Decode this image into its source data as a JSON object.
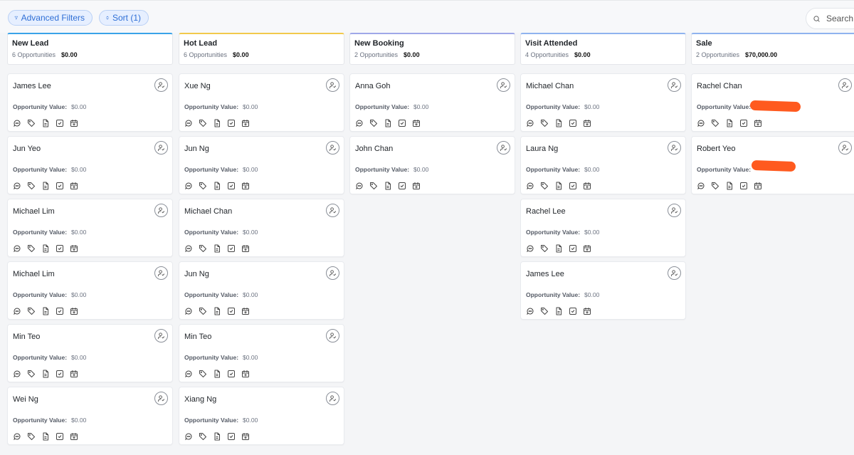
{
  "toolbar": {
    "filters_label": "Advanced Filters",
    "sort_label": "Sort (1)",
    "search_placeholder": "Search"
  },
  "card_labels": {
    "opportunity_value": "Opportunity Value:"
  },
  "colors": {
    "accent": "#2f6fd6",
    "redaction": "#ff5a1f"
  },
  "columns": [
    {
      "title": "New Lead",
      "count": "6 Opportunities",
      "amount": "$0.00",
      "accent": "#3aa3e8",
      "cards": [
        {
          "name": "James Lee",
          "value": "$0.00"
        },
        {
          "name": "Jun Yeo",
          "value": "$0.00"
        },
        {
          "name": "Michael Lim",
          "value": "$0.00"
        },
        {
          "name": "Michael Lim",
          "value": "$0.00"
        },
        {
          "name": "Min Teo",
          "value": "$0.00"
        },
        {
          "name": "Wei Ng",
          "value": "$0.00"
        }
      ]
    },
    {
      "title": "Hot Lead",
      "count": "6 Opportunities",
      "amount": "$0.00",
      "accent": "#f2c94c",
      "cards": [
        {
          "name": "Xue Ng",
          "value": "$0.00"
        },
        {
          "name": "Jun Ng",
          "value": "$0.00"
        },
        {
          "name": "Michael Chan",
          "value": "$0.00"
        },
        {
          "name": "Jun Ng",
          "value": "$0.00"
        },
        {
          "name": "Min Teo",
          "value": "$0.00"
        },
        {
          "name": "Xiang Ng",
          "value": "$0.00"
        }
      ]
    },
    {
      "title": "New Booking",
      "count": "2 Opportunities",
      "amount": "$0.00",
      "accent": "#9fa8e8",
      "cards": [
        {
          "name": "Anna Goh",
          "value": "$0.00"
        },
        {
          "name": "John Chan",
          "value": "$0.00"
        }
      ]
    },
    {
      "title": "Visit Attended",
      "count": "4 Opportunities",
      "amount": "$0.00",
      "accent": "#8fb3ef",
      "cards": [
        {
          "name": "Michael Chan",
          "value": "$0.00"
        },
        {
          "name": "Laura Ng",
          "value": "$0.00"
        },
        {
          "name": "Rachel Lee",
          "value": "$0.00"
        },
        {
          "name": "James Lee",
          "value": "$0.00"
        }
      ]
    },
    {
      "title": "Sale",
      "count": "2 Opportunities",
      "amount": "$70,000.00",
      "accent": "#8fb3ef",
      "cards": [
        {
          "name": "Rachel Chan",
          "value": "",
          "redacted": true
        },
        {
          "name": "Robert Yeo",
          "value": "",
          "redacted": true
        }
      ]
    }
  ]
}
